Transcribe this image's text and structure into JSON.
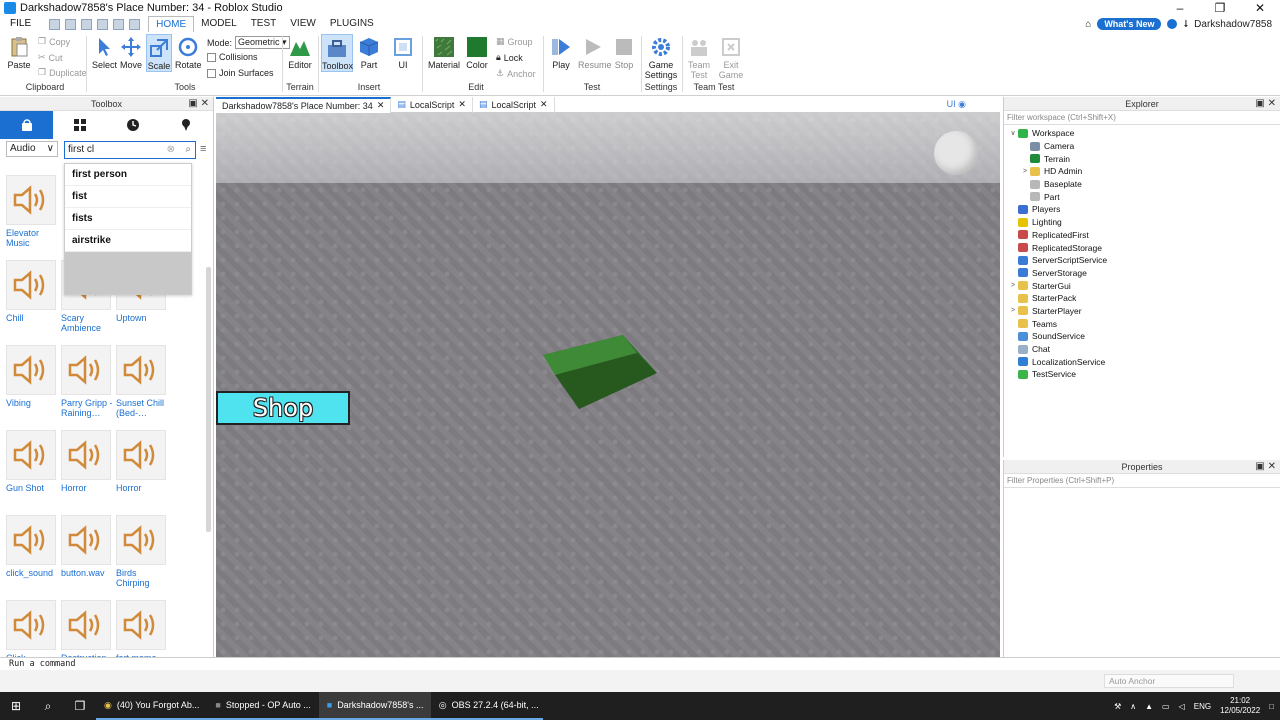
{
  "window": {
    "title": "Darkshadow7858's Place Number: 34 - Roblox Studio"
  },
  "menubar": {
    "file": "FILE",
    "tabs": [
      "HOME",
      "MODEL",
      "TEST",
      "VIEW",
      "PLUGINS"
    ],
    "active_tab": "HOME",
    "whats_new": "What's New",
    "username": "Darkshadow7858"
  },
  "ribbon": {
    "clipboard": {
      "paste": "Paste",
      "copy": "Copy",
      "cut": "Cut",
      "duplicate": "Duplicate",
      "label": "Clipboard"
    },
    "tools": {
      "select": "Select",
      "move": "Move",
      "scale": "Scale",
      "rotate": "Rotate",
      "mode_label": "Mode:",
      "mode_value": "Geometric",
      "collisions": "Collisions",
      "join_surfaces": "Join Surfaces",
      "label": "Tools"
    },
    "terrain": {
      "editor": "Editor",
      "label": "Terrain"
    },
    "insert": {
      "toolbox": "Toolbox",
      "part": "Part",
      "ui": "UI",
      "label": "Insert"
    },
    "edit": {
      "material": "Material",
      "color": "Color",
      "group": "Group",
      "lock": "Lock",
      "anchor": "Anchor",
      "label": "Edit"
    },
    "test": {
      "play": "Play",
      "resume": "Resume",
      "stop": "Stop",
      "label": "Test"
    },
    "settings": {
      "game_settings_1": "Game",
      "game_settings_2": "Settings",
      "label": "Settings"
    },
    "team_test": {
      "team_test_1": "Team",
      "team_test_2": "Test",
      "exit_game_1": "Exit",
      "exit_game_2": "Game",
      "label": "Team Test"
    }
  },
  "toolbox": {
    "title": "Toolbox",
    "category": "Audio",
    "search_value": "first cl",
    "suggestions": [
      "first person",
      "fist",
      "fists",
      "airstrike"
    ],
    "assets": [
      {
        "name": "Elevator Music"
      },
      {
        "name": "Chill"
      },
      {
        "name": "Scary Ambience"
      },
      {
        "name": "Uptown"
      },
      {
        "name": "Vibing"
      },
      {
        "name": "Parry Gripp - Raining…"
      },
      {
        "name": "Sunset Chill (Bed-…"
      },
      {
        "name": "Gun Shot"
      },
      {
        "name": "Horror"
      },
      {
        "name": "Horror"
      },
      {
        "name": "click_sound"
      },
      {
        "name": "button.wav"
      },
      {
        "name": "Birds Chirping"
      },
      {
        "name": "Click"
      },
      {
        "name": "Destruction"
      },
      {
        "name": "fart meme"
      }
    ]
  },
  "doctabs": [
    "Darkshadow7858's Place Number: 34",
    "LocalScript",
    "LocalScript"
  ],
  "viewport": {
    "shop_label": "Shop"
  },
  "explorer": {
    "title": "Explorer",
    "filter_placeholder": "Filter workspace (Ctrl+Shift+X)",
    "nodes": [
      {
        "name": "Workspace",
        "depth": 0,
        "toggle": "∨",
        "color": "#2fb44a"
      },
      {
        "name": "Camera",
        "depth": 1,
        "toggle": "",
        "color": "#7a8ea6"
      },
      {
        "name": "Terrain",
        "depth": 1,
        "toggle": "",
        "color": "#1f8a3a"
      },
      {
        "name": "HD Admin",
        "depth": 1,
        "toggle": ">",
        "color": "#e8c14b"
      },
      {
        "name": "Baseplate",
        "depth": 1,
        "toggle": "",
        "color": "#b8b8b8"
      },
      {
        "name": "Part",
        "depth": 1,
        "toggle": "",
        "color": "#b8b8b8"
      },
      {
        "name": "Players",
        "depth": 0,
        "toggle": "",
        "color": "#3a6fd1"
      },
      {
        "name": "Lighting",
        "depth": 0,
        "toggle": "",
        "color": "#e6c200"
      },
      {
        "name": "ReplicatedFirst",
        "depth": 0,
        "toggle": "",
        "color": "#c84a4a"
      },
      {
        "name": "ReplicatedStorage",
        "depth": 0,
        "toggle": "",
        "color": "#c84a4a"
      },
      {
        "name": "ServerScriptService",
        "depth": 0,
        "toggle": "",
        "color": "#3a7bd5"
      },
      {
        "name": "ServerStorage",
        "depth": 0,
        "toggle": "",
        "color": "#3a7bd5"
      },
      {
        "name": "StarterGui",
        "depth": 0,
        "toggle": ">",
        "color": "#e8c14b"
      },
      {
        "name": "StarterPack",
        "depth": 0,
        "toggle": "",
        "color": "#e8c14b"
      },
      {
        "name": "StarterPlayer",
        "depth": 0,
        "toggle": ">",
        "color": "#e8c14b"
      },
      {
        "name": "Teams",
        "depth": 0,
        "toggle": "",
        "color": "#e8c14b"
      },
      {
        "name": "SoundService",
        "depth": 0,
        "toggle": "",
        "color": "#4a8fd8"
      },
      {
        "name": "Chat",
        "depth": 0,
        "toggle": "",
        "color": "#9ab0c8"
      },
      {
        "name": "LocalizationService",
        "depth": 0,
        "toggle": "",
        "color": "#2f7fd5"
      },
      {
        "name": "TestService",
        "depth": 0,
        "toggle": "",
        "color": "#3cb44a"
      }
    ]
  },
  "properties": {
    "title": "Properties",
    "filter_placeholder": "Filter Properties (Ctrl+Shift+P)"
  },
  "commandbar": {
    "placeholder": "Run a command"
  },
  "status": {
    "auto_anchor": "Auto Anchor"
  },
  "taskbar": {
    "apps": [
      {
        "label": "(40) You Forgot Ab..."
      },
      {
        "label": "Stopped - OP Auto ..."
      },
      {
        "label": "Darkshadow7858's ..."
      },
      {
        "label": "OBS 27.2.4 (64-bit, ..."
      }
    ],
    "lang": "ENG",
    "time": "21:02",
    "date": "12/05/2022"
  }
}
